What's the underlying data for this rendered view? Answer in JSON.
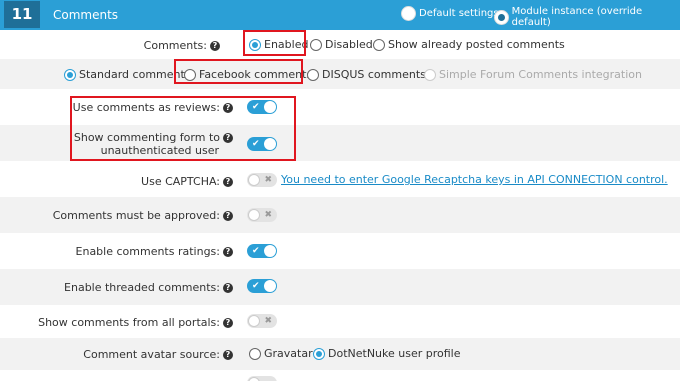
{
  "header": {
    "number": "11",
    "title": "Comments",
    "default_settings": "Default settings",
    "module_instance": "Module instance (override default)"
  },
  "comments": {
    "label": "Comments:",
    "options": [
      "Enabled",
      "Disabled",
      "Show already posted comments"
    ],
    "selected": "Enabled"
  },
  "providers": {
    "options": [
      "Standard comments",
      "Facebook comments",
      "DISQUS comments",
      "Simple Forum Comments integration"
    ],
    "selected": "Standard comments",
    "disabled": "Simple Forum Comments integration"
  },
  "settings": {
    "reviews": {
      "label": "Use comments as reviews:",
      "state": "on"
    },
    "unauth_line1": "Show commenting form to",
    "unauth_line2": "unauthenticated user",
    "unauth_state": "on",
    "captcha": {
      "label": "Use CAPTCHA:",
      "state": "off",
      "link": "You need to enter Google Recaptcha keys in API CONNECTION control."
    },
    "approved": {
      "label": "Comments must be approved:",
      "state": "off"
    },
    "ratings": {
      "label": "Enable comments ratings:",
      "state": "on"
    },
    "threaded": {
      "label": "Enable threaded comments:",
      "state": "on"
    },
    "all_portals": {
      "label": "Show comments from all portals:",
      "state": "off"
    },
    "avatar": {
      "label": "Comment avatar source:",
      "options": [
        "Gravatar",
        "DotNetNuke user profile"
      ],
      "selected": "DotNetNuke user profile"
    }
  },
  "icons": {
    "help": "?",
    "check": "✔",
    "cross": "✖"
  },
  "colors": {
    "accent": "#2b9fd6",
    "header_dark": "#1f6f98",
    "highlight": "#e0161f"
  }
}
